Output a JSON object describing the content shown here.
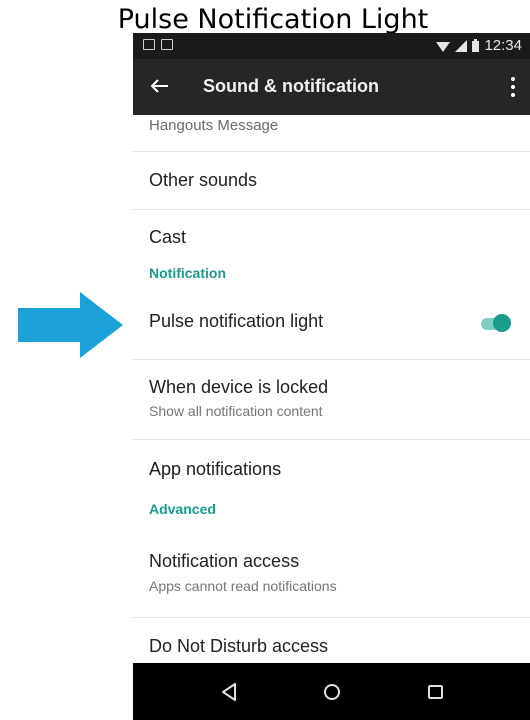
{
  "page_title": "Pulse Notification Light",
  "status_bar": {
    "time": "12:34"
  },
  "app_bar": {
    "title": "Sound & notification"
  },
  "list": {
    "partial_item": "Hangouts Message",
    "other_sounds": "Other sounds",
    "cast": "Cast",
    "section_notification": "Notification",
    "pulse_light": {
      "label": "Pulse notification light",
      "enabled": true
    },
    "when_locked": {
      "label": "When device is locked",
      "summary": "Show all notification content"
    },
    "app_notifications": "App notifications",
    "section_advanced": "Advanced",
    "notification_access": {
      "label": "Notification access",
      "summary": "Apps cannot read notifications"
    },
    "dnd_access": "Do Not Disturb access"
  },
  "colors": {
    "accent": "#1a9b8c",
    "arrow": "#1ba1d8",
    "status_bar": "#1b1b1b",
    "app_bar": "#262626"
  },
  "icons": {
    "back": "arrow-left-icon",
    "overflow": "more-vert-icon",
    "nav_back": "triangle-back-icon",
    "nav_home": "circle-home-icon",
    "nav_recents": "square-recents-icon"
  }
}
